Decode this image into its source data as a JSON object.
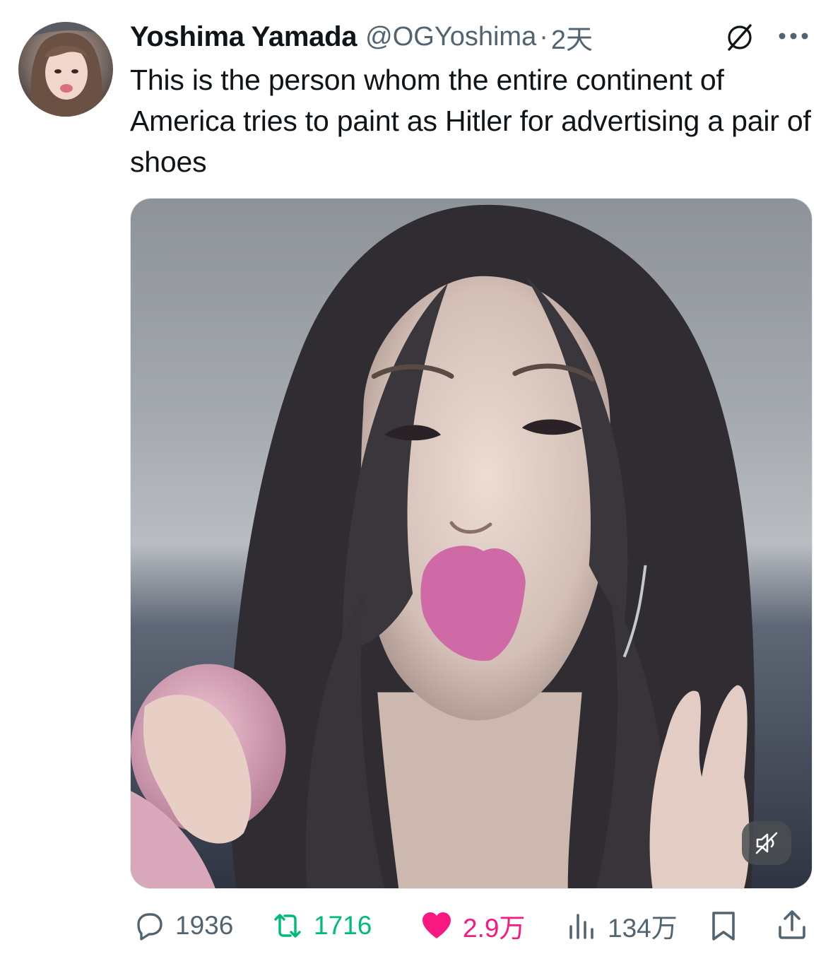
{
  "author": {
    "display_name": "Yoshima Yamada",
    "handle": "@OGYoshima",
    "separator": "·",
    "timestamp": "2天"
  },
  "tweet": {
    "text": "This is the person whom the entire continent of America tries to paint as Hitler for advertising a pair of shoes"
  },
  "media": {
    "type": "video",
    "mute_icon": "speaker-muted-icon"
  },
  "actions": {
    "replies": "1936",
    "retweets": "1716",
    "likes": "2.9万",
    "views": "134万"
  },
  "colors": {
    "text_primary": "#0f1419",
    "text_secondary": "#536471",
    "retweet_green": "#00ba7c",
    "like_pink": "#f91880"
  },
  "icons": {
    "header": [
      "grok-icon",
      "more-icon"
    ],
    "actions": [
      "reply-icon",
      "retweet-icon",
      "like-icon",
      "views-icon",
      "bookmark-icon",
      "share-icon"
    ]
  }
}
